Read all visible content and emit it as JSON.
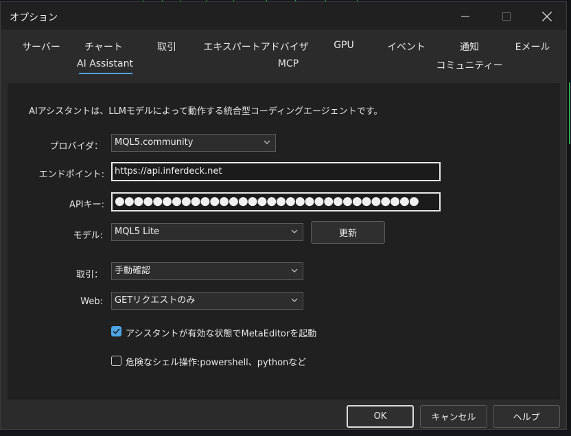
{
  "window": {
    "title": "オプション"
  },
  "tabs": {
    "row1": [
      "サーバー",
      "チャート",
      "取引",
      "エキスパートアドバイザ",
      "GPU",
      "イベント",
      "通知",
      "Eメール"
    ],
    "row2": [
      "AI Assistant",
      "MCP",
      "コミュニティー"
    ],
    "active": "AI Assistant"
  },
  "description": "AIアシスタントは、LLMモデルによって動作する統合型コーディングエージェントです。",
  "form": {
    "provider": {
      "label": "プロバイダ：",
      "value": "MQL5.community"
    },
    "endpoint": {
      "label": "エンドポイント:",
      "value": "https://api.inferdeck.net"
    },
    "api_key": {
      "label": "APIキー:",
      "value": "●●●●●●●●●●●●●●●●●●●●●●●●●●●●●●●●"
    },
    "model": {
      "label": "モデル:",
      "value": "MQL5 Lite",
      "refresh_label": "更新"
    },
    "trade": {
      "label": "取引：",
      "value": "手動確認"
    },
    "web": {
      "label": "Web:",
      "value": "GETリクエストのみ"
    }
  },
  "checkboxes": [
    {
      "label": "アシスタントが有効な状態でMetaEditorを起動",
      "checked": true
    },
    {
      "label": "危険なシェル操作:powershell、pythonなど",
      "checked": false
    }
  ],
  "footer": {
    "ok": "OK",
    "cancel": "キャンセル",
    "help": "ヘルプ"
  },
  "colors": {
    "accent": "#4fa3e8",
    "checkbox_checked": "#4ea5e6"
  },
  "icons": [
    "minimize-icon",
    "maximize-icon",
    "close-icon",
    "chevron-down-icon",
    "checkmark-icon"
  ]
}
